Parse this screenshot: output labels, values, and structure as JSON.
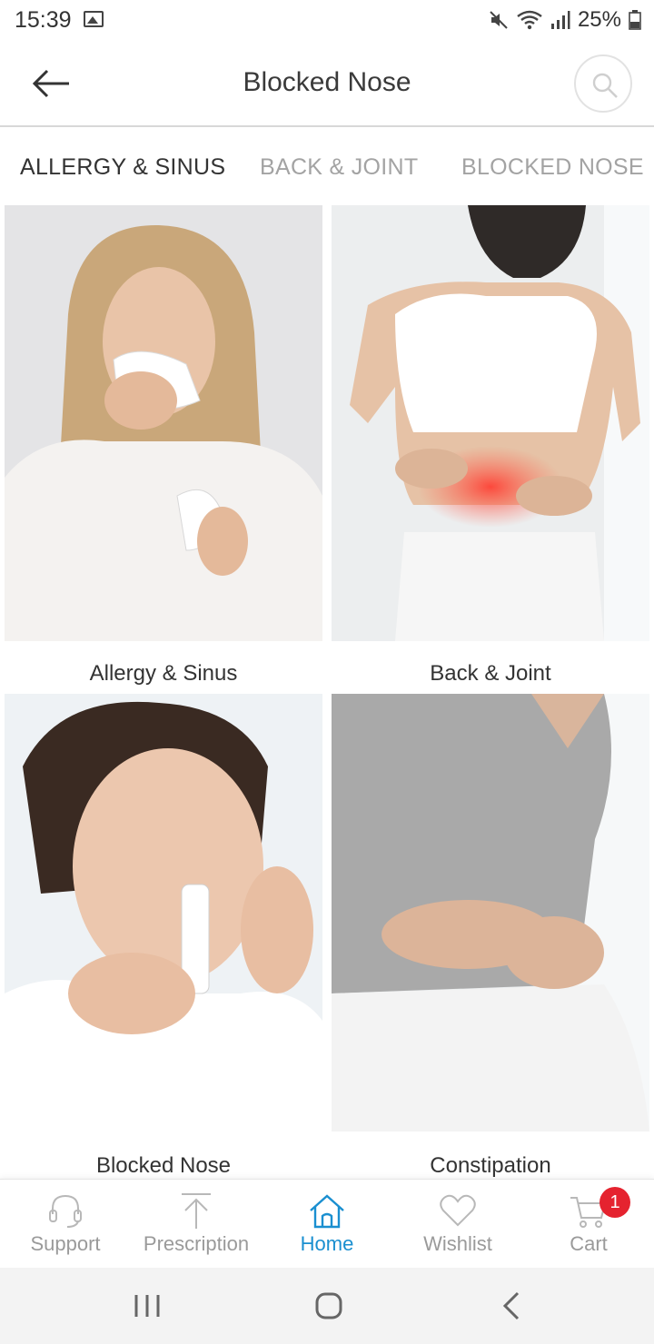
{
  "status_bar": {
    "time": "15:39",
    "battery": "25%"
  },
  "app_bar": {
    "title": "Blocked Nose"
  },
  "tabs": [
    {
      "label": "ALLERGY & SINUS",
      "active": true
    },
    {
      "label": "BACK & JOINT",
      "active": false
    },
    {
      "label": "BLOCKED NOSE",
      "active": false
    }
  ],
  "categories": [
    {
      "label": "Allergy & Sinus"
    },
    {
      "label": "Back & Joint"
    },
    {
      "label": "Blocked Nose"
    },
    {
      "label": "Constipation"
    }
  ],
  "bottom_nav": [
    {
      "label": "Support",
      "icon": "headset-icon"
    },
    {
      "label": "Prescription",
      "icon": "upload-icon"
    },
    {
      "label": "Home",
      "icon": "home-icon",
      "active": true
    },
    {
      "label": "Wishlist",
      "icon": "heart-icon"
    },
    {
      "label": "Cart",
      "icon": "cart-icon",
      "badge": "1"
    }
  ],
  "colors": {
    "accent": "#1a8fd0",
    "badge": "#e5232f",
    "inactive_text": "#a3a3a3"
  }
}
